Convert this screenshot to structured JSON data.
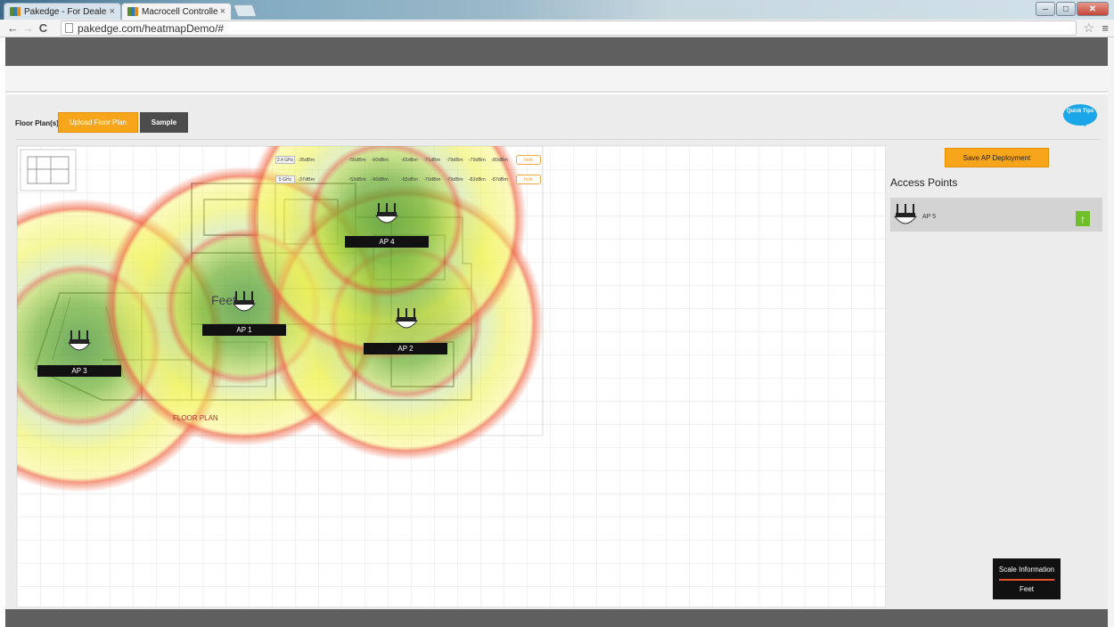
{
  "browser": {
    "tabs": [
      {
        "title": "Pakedge - For Dealers - D",
        "active": false
      },
      {
        "title": "Macrocell Controller",
        "active": true
      }
    ],
    "url": "pakedge.com/heatmapDemo/#"
  },
  "toolbar": {
    "floor_plans_label": "Floor Plan(s)",
    "upload_label": "Upload Floor Plan",
    "sample_label": "Sample",
    "quick_tips_label": "Quick Tips"
  },
  "legend": {
    "rows": [
      {
        "band": "2.4 GHz",
        "levels": [
          "-35dBm",
          "-55dBm",
          "-60dBm",
          "-65dBm",
          "-71dBm",
          "-79dBm",
          "-79dBm",
          "-80dBm"
        ],
        "hide_label": "hide"
      },
      {
        "band": "5 GHz",
        "levels": [
          "-37dBm",
          "-53dBm",
          "-60dBm",
          "-65dBm",
          "-70dBm",
          "-79dBm",
          "-82dBm",
          "-87dBm"
        ],
        "hide_label": "hide"
      }
    ]
  },
  "floor_plan": {
    "feet_label": "Feet",
    "caption": "FLOOR PLAN"
  },
  "access_points_on_map": [
    {
      "label": "AP 1"
    },
    {
      "label": "AP 2"
    },
    {
      "label": "AP 3"
    },
    {
      "label": "AP 4"
    }
  ],
  "sidebar": {
    "save_label": "Save AP Deployment",
    "title": "Access Points",
    "items": [
      {
        "label": "AP 5"
      }
    ]
  },
  "scale": {
    "title": "Scale Information",
    "unit": "Feet"
  },
  "colors": {
    "accent": "#f7a61c",
    "header": "#5f5f5f",
    "coverage_strong": "#2e8b2e",
    "coverage_medium": "#9bd12b",
    "coverage_weak": "#f4f04a",
    "coverage_edge": "#ef5a3c",
    "quick_tips": "#1aa6e8"
  }
}
